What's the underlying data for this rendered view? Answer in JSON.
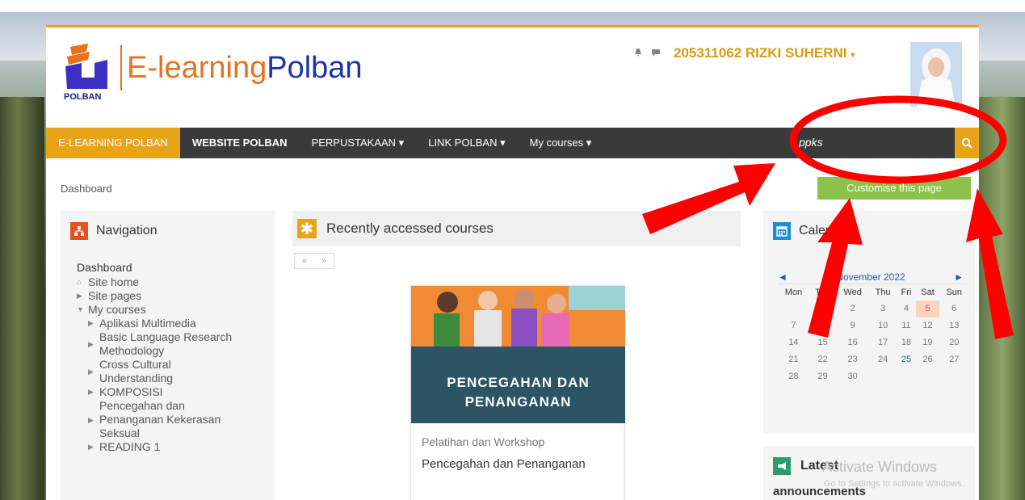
{
  "header": {
    "logo_text": "POLBAN",
    "brand_part1": "E-learning",
    "brand_part2": "Polban",
    "user_name": "205311062 RIZKI SUHERNI",
    "user_caret": "▾"
  },
  "navbar": {
    "items": [
      {
        "label": "E-LEARNING POLBAN"
      },
      {
        "label": "WEBSITE POLBAN"
      },
      {
        "label": "PERPUSTAKAAN ▾"
      },
      {
        "label": "LINK POLBAN ▾"
      },
      {
        "label": "My courses ▾"
      }
    ],
    "search_value": "ppks"
  },
  "breadcrumb": "Dashboard",
  "customise_button": "Customise this page",
  "navigation": {
    "title": "Navigation",
    "dashboard": "Dashboard",
    "site_home": "Site home",
    "site_pages": "Site pages",
    "my_courses": "My courses",
    "courses": [
      "Aplikasi Multimedia",
      "Basic Language Research Methodology",
      "Cross Cultural Understanding",
      "KOMPOSISI",
      "Pencegahan dan Penanganan Kekerasan Seksual",
      "READING 1"
    ]
  },
  "recent": {
    "title": "Recently accessed courses",
    "prev": "«",
    "next": "»",
    "card_image_line1": "PENCEGAHAN DAN",
    "card_image_line2": "PENANGANAN",
    "card_category": "Pelatihan dan Workshop",
    "card_name": "Pencegahan dan Penanganan"
  },
  "calendar": {
    "title": "Calendar",
    "month": "November 2022",
    "days": [
      "Mon",
      "Tue",
      "Wed",
      "Thu",
      "Fri",
      "Sat",
      "Sun"
    ],
    "weeks": [
      [
        "",
        "1",
        "2",
        "3",
        "4",
        "5",
        "6"
      ],
      [
        "7",
        "8",
        "9",
        "10",
        "11",
        "12",
        "13"
      ],
      [
        "14",
        "15",
        "16",
        "17",
        "18",
        "19",
        "20"
      ],
      [
        "21",
        "22",
        "23",
        "24",
        "25",
        "26",
        "27"
      ],
      [
        "28",
        "29",
        "30",
        "",
        "",
        "",
        ""
      ]
    ]
  },
  "announcements": {
    "title": "Latest",
    "subtitle": "announcements"
  },
  "watermark": {
    "line1": "Activate Windows",
    "line2": "Go to Settings to activate Windows."
  },
  "colors": {
    "accent": "#e8a419",
    "navbar": "#3a3a3a",
    "annotation": "#ff0000"
  }
}
